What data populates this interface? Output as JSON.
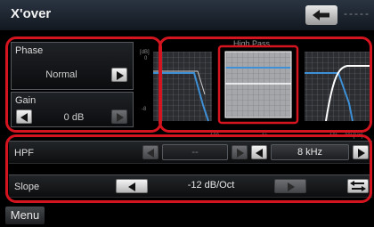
{
  "header": {
    "title": "X'over",
    "status_dashes": "-----"
  },
  "phase": {
    "label": "Phase",
    "value": "Normal"
  },
  "gain": {
    "label": "Gain",
    "value": "0 dB"
  },
  "graph": {
    "mode_label": "High Pass",
    "y_tick_top": "[dB]",
    "y_tick_top2": "0",
    "y_tick_mid": "-8",
    "x_ticks": [
      "100",
      "1k",
      "10k",
      "20k[Hz]"
    ]
  },
  "hpf": {
    "label": "HPF",
    "value_left": "--",
    "value_right": "8 kHz"
  },
  "slope": {
    "label": "Slope",
    "value": "-12 dB/Oct"
  },
  "footer": {
    "menu_label": "Menu"
  },
  "colors": {
    "accent_red": "#d4141e",
    "curve_blue": "#3d8fd6",
    "curve_white": "#ffffff"
  }
}
